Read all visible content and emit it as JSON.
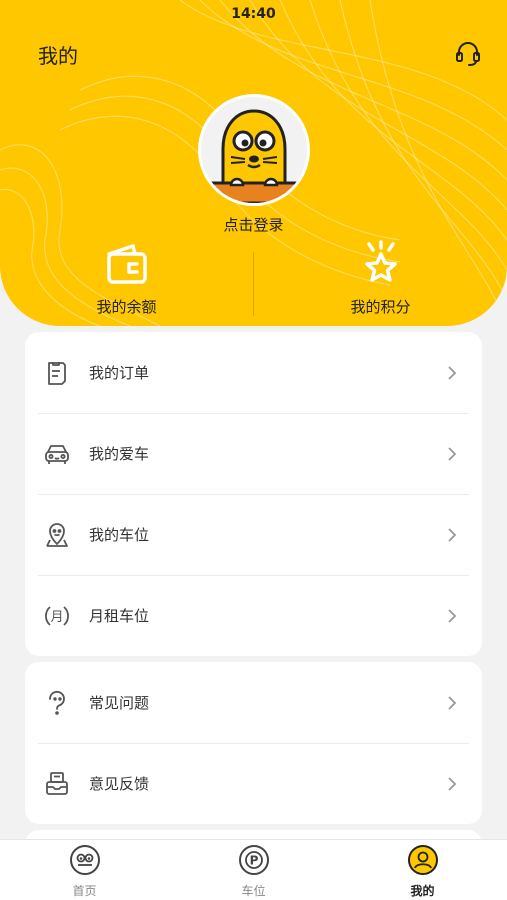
{
  "status_bar": {
    "time": "14:40"
  },
  "header": {
    "title": "我的",
    "login_label": "点击登录"
  },
  "stats": [
    {
      "label": "我的余额",
      "icon": "wallet-icon"
    },
    {
      "label": "我的积分",
      "icon": "star-icon"
    }
  ],
  "menu_group_1": [
    {
      "label": "我的订单",
      "icon": "order-icon"
    },
    {
      "label": "我的爱车",
      "icon": "car-icon"
    },
    {
      "label": "我的车位",
      "icon": "parking-location-icon"
    },
    {
      "label": "月租车位",
      "icon": "monthly-rent-icon"
    }
  ],
  "menu_group_2": [
    {
      "label": "常见问题",
      "icon": "faq-icon"
    },
    {
      "label": "意见反馈",
      "icon": "feedback-icon"
    }
  ],
  "tabs": [
    {
      "label": "首页",
      "icon": "home-mascot-icon",
      "active": false
    },
    {
      "label": "车位",
      "icon": "parking-icon",
      "active": false
    },
    {
      "label": "我的",
      "icon": "profile-icon",
      "active": true
    }
  ],
  "colors": {
    "brand": "#fec700",
    "background": "#f2f2f2",
    "card": "#ffffff",
    "text": "#333333"
  }
}
